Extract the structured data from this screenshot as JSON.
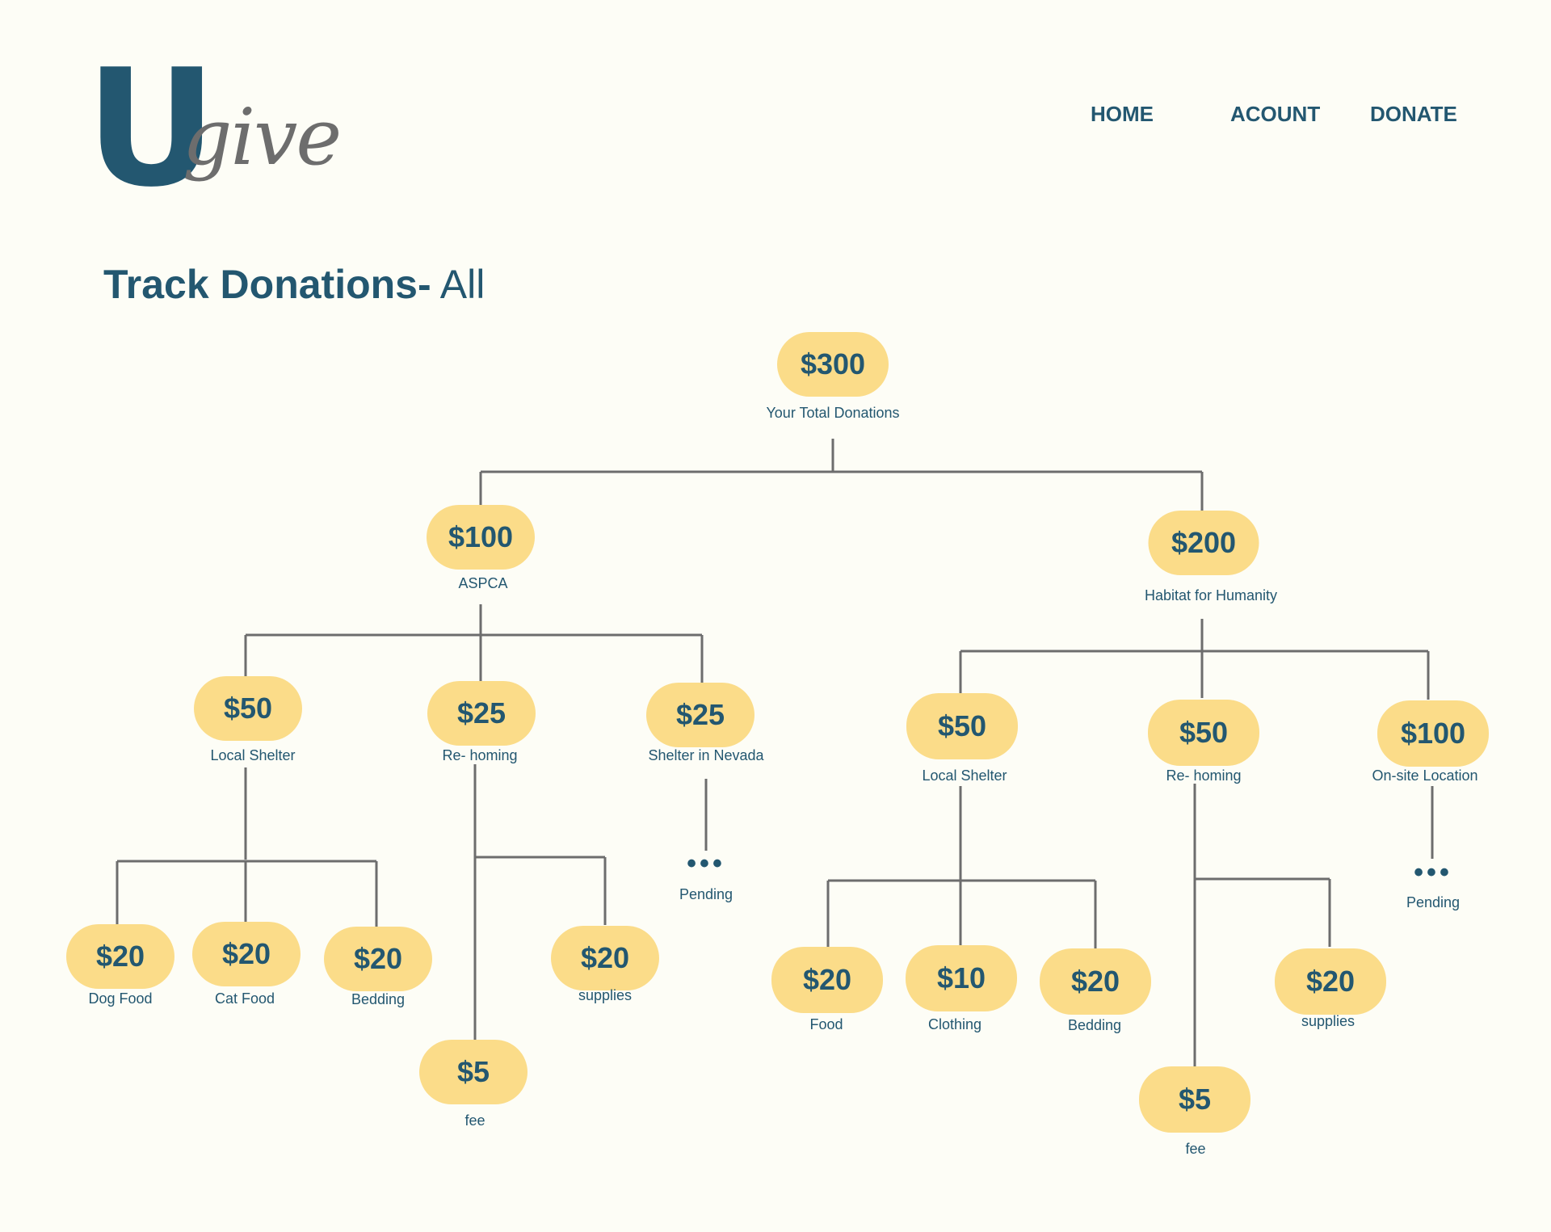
{
  "logo": {
    "u": "U",
    "give": "give"
  },
  "nav": {
    "home": "HOME",
    "account": "ACOUNT",
    "donate": "DONATE"
  },
  "page": {
    "title_bold": "Track Donations-",
    "title_light": "All"
  },
  "tree": {
    "total": {
      "amount": "$300",
      "label": "Your Total Donations"
    },
    "aspca": {
      "amount": "$100",
      "label": "ASPCA",
      "local_shelter": {
        "amount": "$50",
        "label": "Local Shelter",
        "dog_food": {
          "amount": "$20",
          "label": "Dog Food"
        },
        "cat_food": {
          "amount": "$20",
          "label": "Cat Food"
        },
        "bedding": {
          "amount": "$20",
          "label": "Bedding"
        }
      },
      "rehoming": {
        "amount": "$25",
        "label": "Re- homing",
        "fee": {
          "amount": "$5",
          "label": "fee"
        },
        "supplies": {
          "amount": "$20",
          "label": "supplies"
        }
      },
      "nevada": {
        "amount": "$25",
        "label": "Shelter in Nevada",
        "pending_dots": "•••",
        "pending": "Pending"
      }
    },
    "habitat": {
      "amount": "$200",
      "label": "Habitat for Humanity",
      "local_shelter": {
        "amount": "$50",
        "label": "Local Shelter",
        "food": {
          "amount": "$20",
          "label": "Food"
        },
        "clothing": {
          "amount": "$10",
          "label": "Clothing"
        },
        "bedding": {
          "amount": "$20",
          "label": "Bedding"
        }
      },
      "rehoming": {
        "amount": "$50",
        "label": "Re- homing",
        "fee": {
          "amount": "$5",
          "label": "fee"
        },
        "supplies": {
          "amount": "$20",
          "label": "supplies"
        }
      },
      "onsite": {
        "amount": "$100",
        "label": "On-site Location",
        "pending_dots": "•••",
        "pending": "Pending"
      }
    }
  },
  "colors": {
    "accent": "#235770",
    "node_fill": "#fbdc89",
    "line": "#6d6d6d",
    "background": "#fdfdf6",
    "logo_grey": "#6d6d6d"
  }
}
